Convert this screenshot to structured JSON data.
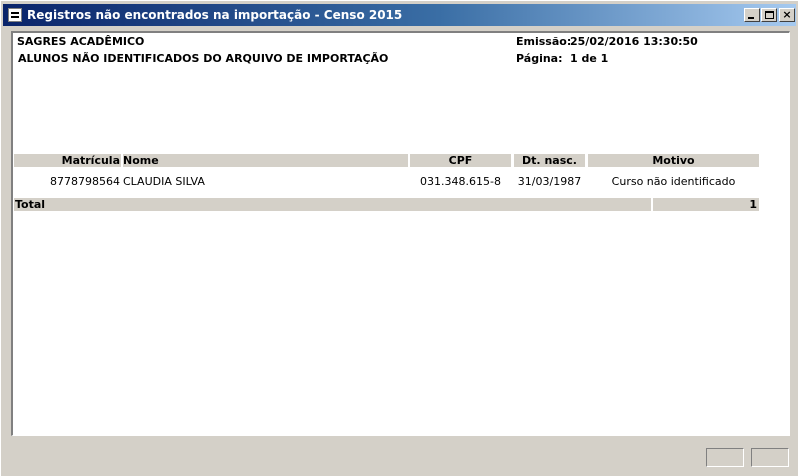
{
  "window": {
    "title": "Registros não encontrados na importação - Censo 2015",
    "controls": {
      "minimize": "minimize",
      "maximize": "maximize",
      "close": "×"
    }
  },
  "report": {
    "company": "SAGRES ACADÊMICO",
    "subtitle": "ALUNOS NÃO IDENTIFICADOS DO ARQUIVO DE IMPORTAÇÃO",
    "emission_label": "Emissão:",
    "emission_value": "25/02/2016 13:30:50",
    "page_label": "Página:",
    "page_value": "1 de 1",
    "columns": {
      "matricula": "Matrícula",
      "nome": "Nome",
      "cpf": "CPF",
      "dt_nasc": "Dt. nasc.",
      "motivo": "Motivo"
    },
    "rows": [
      {
        "matricula": "8778798564",
        "nome": "CLAUDIA SILVA",
        "cpf": "031.348.615-8",
        "dt_nasc": "31/03/1987",
        "motivo": "Curso não identificado"
      }
    ],
    "total_label": "Total",
    "total_value": "1"
  }
}
